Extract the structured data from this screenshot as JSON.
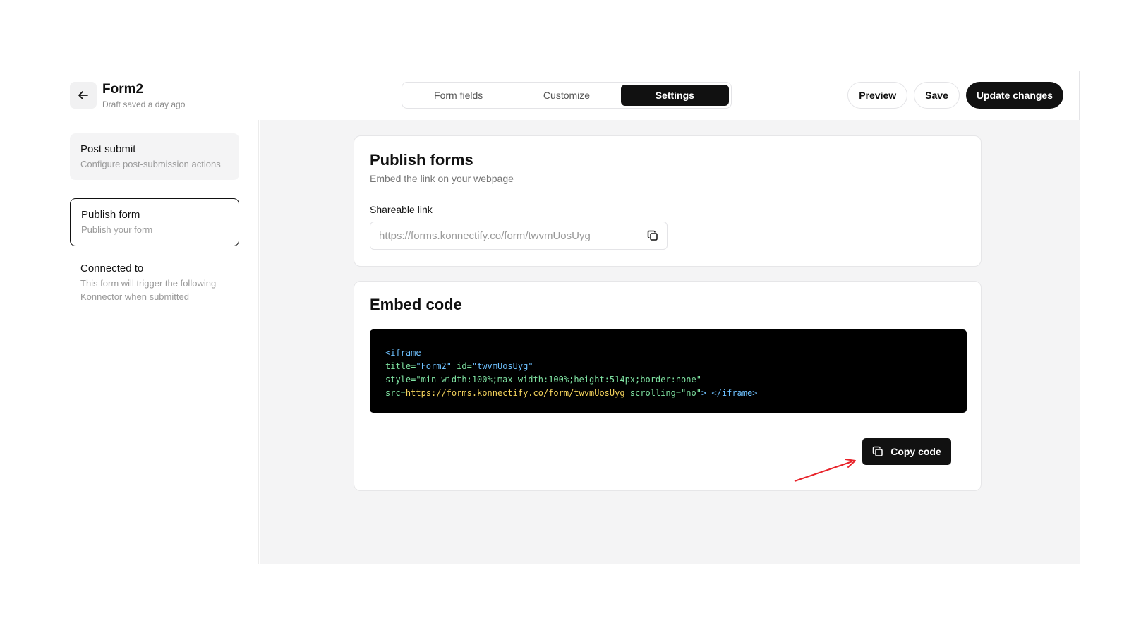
{
  "header": {
    "back_icon": "arrow-left-icon",
    "form_title": "Form2",
    "status": "Draft saved a day ago",
    "tabs": [
      {
        "label": "Form fields",
        "active": false
      },
      {
        "label": "Customize",
        "active": false
      },
      {
        "label": "Settings",
        "active": true
      }
    ],
    "preview_label": "Preview",
    "save_label": "Save",
    "update_label": "Update changes"
  },
  "sidebar": {
    "items": [
      {
        "title": "Post submit",
        "desc": "Configure post-submission actions",
        "state": "grey"
      },
      {
        "title": "Publish form",
        "desc": "Publish your form",
        "state": "selected"
      },
      {
        "title": "Connected to",
        "desc": "This form will trigger the following Konnector when submitted",
        "state": "plain"
      }
    ]
  },
  "publish": {
    "title": "Publish forms",
    "desc": "Embed the link on your webpage",
    "link_label": "Shareable link",
    "link_value": "https://forms.konnectify.co/form/twvmUosUyg",
    "copy_icon": "copy-icon"
  },
  "embed": {
    "title": "Embed code",
    "code": {
      "line1": "<iframe",
      "line2_attr1": "title=",
      "line2_val1": "\"Form2\"",
      "line2_attr2": " id=",
      "line2_val2": "\"twvmUosUyg\"",
      "line3_attr": "style=",
      "line3_val": "\"min-width:100%;max-width:100%;height:514px;border:none\"",
      "line4_attr": "src=",
      "line4_val": "https://forms.konnectify.co/form/twvmUosUyg",
      "line4_attr2": " scrolling=",
      "line4_val2": "\"no\"",
      "line4_end": "> </iframe>"
    },
    "copy_label": "Copy code",
    "copy_icon": "copy-icon"
  },
  "colors": {
    "annotation_arrow": "#e8232a",
    "code_blue": "#6ec1ff",
    "code_green": "#7fe3a2",
    "code_yellow": "#f5d35c"
  }
}
